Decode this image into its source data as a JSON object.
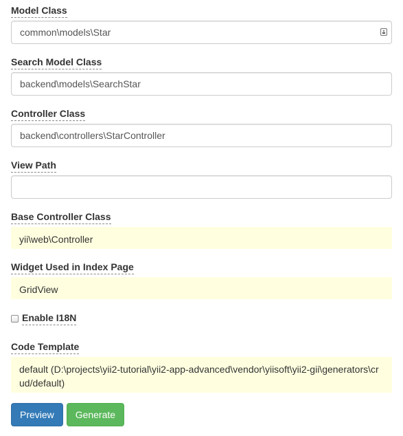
{
  "fields": {
    "model_class": {
      "label": "Model Class",
      "value": "common\\models\\Star"
    },
    "search_model_class": {
      "label": "Search Model Class",
      "value": "backend\\models\\SearchStar"
    },
    "controller_class": {
      "label": "Controller Class",
      "value": "backend\\controllers\\StarController"
    },
    "view_path": {
      "label": "View Path",
      "value": ""
    },
    "base_controller_class": {
      "label": "Base Controller Class",
      "value": "yii\\web\\Controller"
    },
    "widget_used": {
      "label": "Widget Used in Index Page",
      "value": "GridView"
    },
    "enable_i18n": {
      "label": "Enable I18N",
      "checked": false
    },
    "code_template": {
      "label": "Code Template",
      "value": "default (D:\\projects\\yii2-tutorial\\yii2-app-advanced\\vendor\\yiisoft\\yii2-gii\\generators\\crud/default)"
    }
  },
  "buttons": {
    "preview": "Preview",
    "generate": "Generate"
  },
  "icons": {
    "autofill": "contact-card-icon"
  },
  "colors": {
    "primary": "#337ab7",
    "success": "#5cb85c",
    "sticky_bg": "#ffffe0"
  }
}
